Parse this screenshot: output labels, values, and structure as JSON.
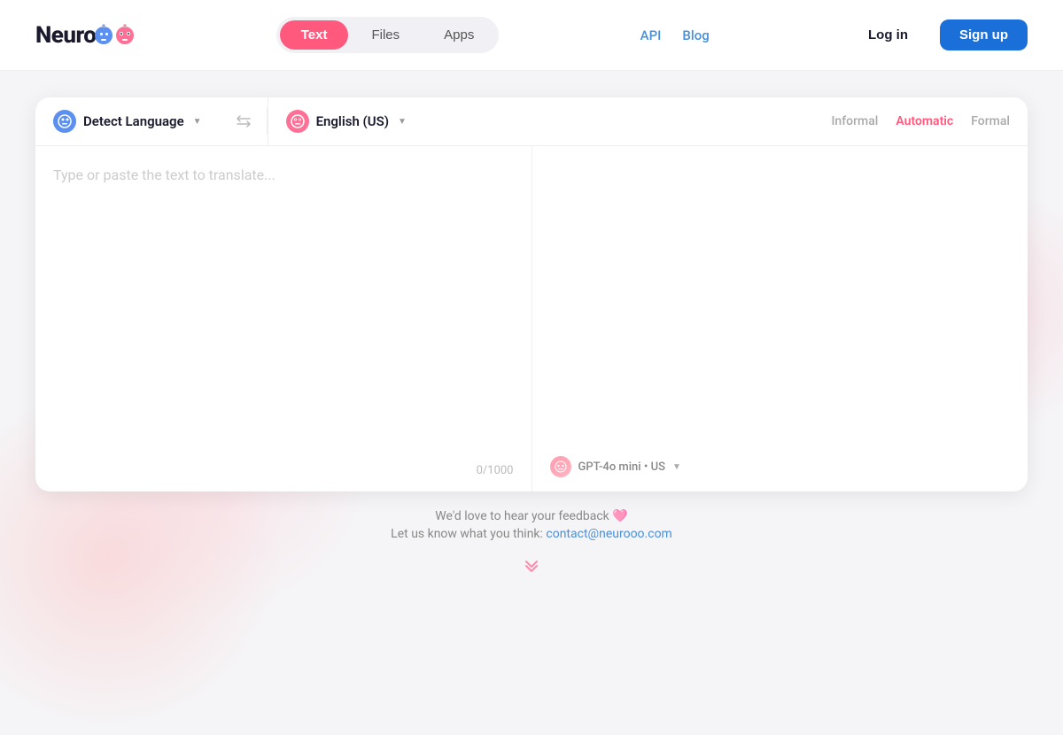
{
  "header": {
    "logo_text": "Neuroo",
    "nav_tabs": [
      {
        "label": "Text",
        "active": true
      },
      {
        "label": "Files",
        "active": false
      },
      {
        "label": "Apps",
        "active": false
      }
    ],
    "nav_links": [
      {
        "label": "API"
      },
      {
        "label": "Blog"
      }
    ],
    "login_label": "Log in",
    "signup_label": "Sign up"
  },
  "translator": {
    "source_lang": "Detect Language",
    "target_lang": "English (US)",
    "swap_icon": "⇄",
    "tone_options": [
      {
        "label": "Informal",
        "active": false
      },
      {
        "label": "Automatic",
        "active": true
      },
      {
        "label": "Formal",
        "active": false
      }
    ],
    "input_placeholder": "Type or paste the text to translate...",
    "char_count": "0/1000",
    "model_label": "GPT-4o mini • US"
  },
  "footer": {
    "feedback_text": "We'd love to hear your feedback 🩷",
    "contact_prefix": "Let us know what you think: ",
    "contact_email": "contact@neurooo.com",
    "contact_href": "mailto:contact@neurooo.com"
  }
}
